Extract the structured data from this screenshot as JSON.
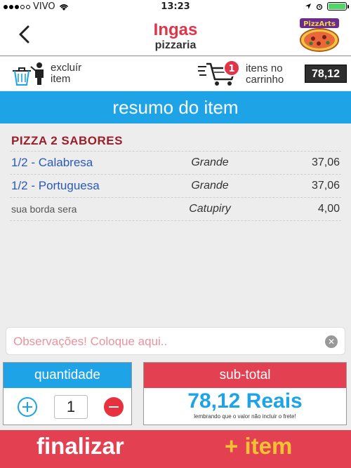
{
  "status_bar": {
    "carrier": "VIVO",
    "time": "13:23"
  },
  "nav": {
    "title": "Ingas",
    "subtitle": "pizzaria",
    "logo_text": "PizzArts"
  },
  "toolbar": {
    "delete_label_1": "excluír",
    "delete_label_2": "item",
    "cart_count": "1",
    "cart_label_1": "itens no",
    "cart_label_2": "carrinho",
    "cart_total": "78,12"
  },
  "section": {
    "title": "resumo do item"
  },
  "item": {
    "group_title": "PIZZA 2 SABORES",
    "rows": [
      {
        "name": "1/2 - Calabresa",
        "size": "Grande",
        "price": "37,06"
      },
      {
        "name": "1/2 - Portuguesa",
        "size": "Grande",
        "price": "37,06"
      },
      {
        "name": "sua borda sera",
        "size": "Catupiry",
        "price": "4,00"
      }
    ]
  },
  "observations": {
    "placeholder": "Observações! Coloque aqui.."
  },
  "quantity": {
    "label": "quantidade",
    "value": "1"
  },
  "subtotal": {
    "label": "sub-total",
    "value": "78,12 Reais",
    "note": "lembrando que o valor não incluir o frete!"
  },
  "footer": {
    "finalize_label": "finalizar",
    "add_item_label": "+ item"
  },
  "colors": {
    "brand_red": "#e34151",
    "accent_blue": "#1ea4e6",
    "title_red": "#e03448",
    "group_dark_red": "#9b1f2a",
    "add_item_yellow": "#f1c233"
  }
}
